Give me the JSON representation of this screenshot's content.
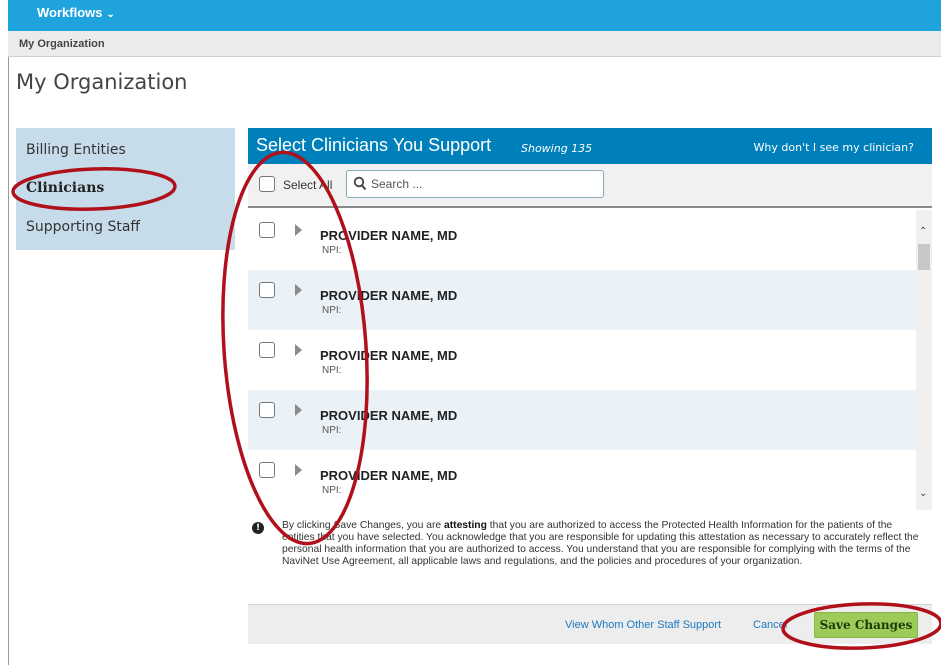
{
  "topbar": {
    "workflows_label": "Workflows",
    "chevron_icon": "chevron-down-icon"
  },
  "breadcrumb": {
    "label": "My Organization"
  },
  "page": {
    "title": "My Organization"
  },
  "sidebar": {
    "items": [
      {
        "label": "Billing Entities",
        "active": false
      },
      {
        "label": "Clinicians",
        "active": true
      },
      {
        "label": "Supporting Staff",
        "active": false
      }
    ]
  },
  "panel": {
    "title": "Select Clinicians You Support",
    "showing": "Showing 135",
    "why_link": "Why don't I see my clinician?"
  },
  "search": {
    "select_all_label": "Select All",
    "placeholder": "Search ...",
    "value": ""
  },
  "providers": [
    {
      "name": "PROVIDER NAME, MD",
      "npi": "NPI:"
    },
    {
      "name": "PROVIDER NAME, MD",
      "npi": "NPI:"
    },
    {
      "name": "PROVIDER NAME, MD",
      "npi": "NPI:"
    },
    {
      "name": "PROVIDER NAME, MD",
      "npi": "NPI:"
    },
    {
      "name": "PROVIDER NAME, MD",
      "npi": "NPI:"
    }
  ],
  "attestation": {
    "before": "By clicking Save Changes, you are ",
    "bold": "attesting",
    "after": " that you are authorized to access the Protected Health Information for the patients of the entities that you have selected. You acknowledge that you are responsible for updating this attestation as necessary to accurately reflect the personal health information that you are authorized to access. You understand that you are responsible for complying with the terms of the NaviNet Use Agreement, all applicable laws and regulations, and the policies and procedures of your organization."
  },
  "footer": {
    "view_link": "View Whom Other Staff Support",
    "cancel_link": "Cancel",
    "save_button": "Save Changes"
  },
  "colors": {
    "topbar": "#1fa3dc",
    "panel_header": "#0080bb",
    "sidebar": "#c6dcea",
    "save_button": "#9ccb5a",
    "annotation": "#b0101a"
  }
}
